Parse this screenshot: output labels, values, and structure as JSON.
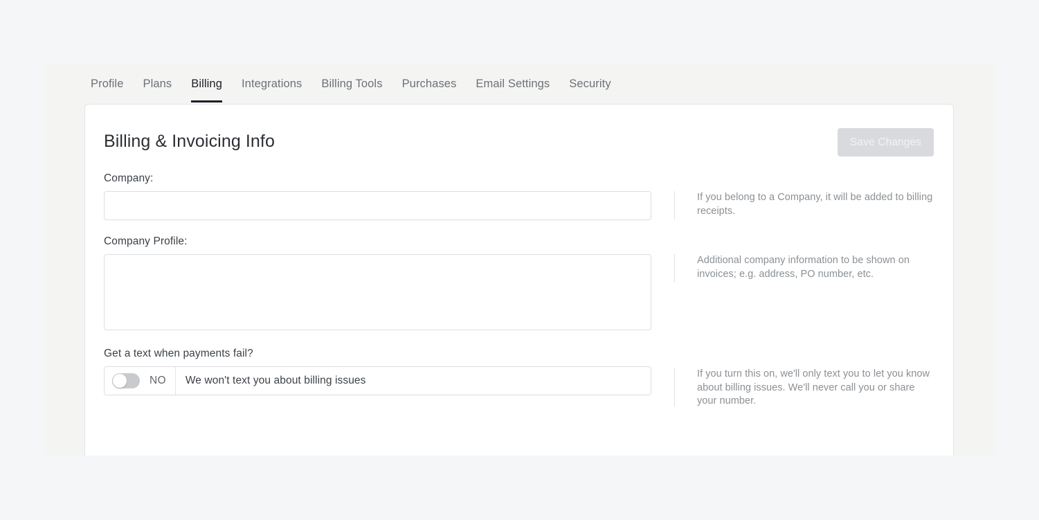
{
  "tabs": [
    {
      "label": "Profile",
      "active": false
    },
    {
      "label": "Plans",
      "active": false
    },
    {
      "label": "Billing",
      "active": true
    },
    {
      "label": "Integrations",
      "active": false
    },
    {
      "label": "Billing Tools",
      "active": false
    },
    {
      "label": "Purchases",
      "active": false
    },
    {
      "label": "Email Settings",
      "active": false
    },
    {
      "label": "Security",
      "active": false
    }
  ],
  "card": {
    "title": "Billing & Invoicing Info",
    "save_button": {
      "label": "Save Changes",
      "state": "disabled"
    }
  },
  "fields": {
    "company": {
      "label": "Company:",
      "value": "",
      "placeholder": "",
      "help": "If you belong to a Company, it will be added to billing receipts."
    },
    "company_profile": {
      "label": "Company Profile:",
      "value": "",
      "placeholder": "",
      "help": "Additional company information to be shown on invoices; e.g. address, PO number, etc."
    },
    "sms_alerts": {
      "label": "Get a text when payments fail?",
      "toggle_state": "NO",
      "toggle_on": false,
      "message": "We won't text you about billing issues",
      "help": "If you turn this on, we'll only text you to let you know about billing issues. We'll never call you or share your number."
    }
  },
  "colors": {
    "page_background": "#f4f6f8",
    "shell_background": "#f4f4f3",
    "card_background": "#ffffff",
    "active_tab": "#1c1f22",
    "inactive_tab": "#6b7177",
    "help_text": "#8b9095",
    "save_button_background": "#d9dadd",
    "save_button_text": "#f2f3f4",
    "toggle_track": "#c9cacd",
    "toggle_knob": "#ffffff",
    "border": "#dcdddf"
  }
}
